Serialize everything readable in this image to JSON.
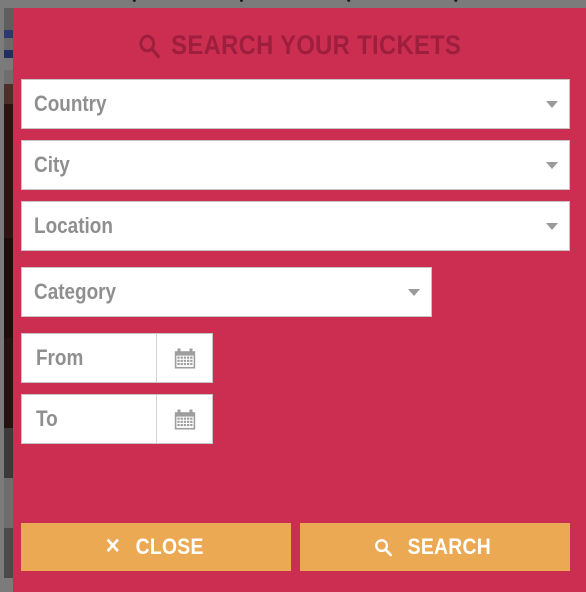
{
  "background": {
    "page_color": "#7b7b7b",
    "overlay_glyphs": "· · · ·"
  },
  "modal": {
    "bg_color": "#cc2e51",
    "title": "SEARCH YOUR TICKETS",
    "title_color": "#9d1e3d",
    "title_icon": "search-icon"
  },
  "fields": {
    "country": {
      "label": "Country",
      "type": "select",
      "caret": "chevron-down-icon"
    },
    "city": {
      "label": "City",
      "type": "select",
      "caret": "chevron-down-icon"
    },
    "location": {
      "label": "Location",
      "type": "select",
      "caret": "chevron-down-icon"
    },
    "category": {
      "label": "Category",
      "type": "select",
      "caret": "chevron-down-icon"
    },
    "from": {
      "label": "From",
      "type": "date",
      "icon": "calendar-icon"
    },
    "to": {
      "label": "To",
      "type": "date",
      "icon": "calendar-icon"
    }
  },
  "footer": {
    "button_color": "#eba954",
    "close_label": "CLOSE",
    "close_icon": "close-x-icon",
    "close_glyph": "✕",
    "search_label": "SEARCH",
    "search_icon": "search-icon"
  }
}
